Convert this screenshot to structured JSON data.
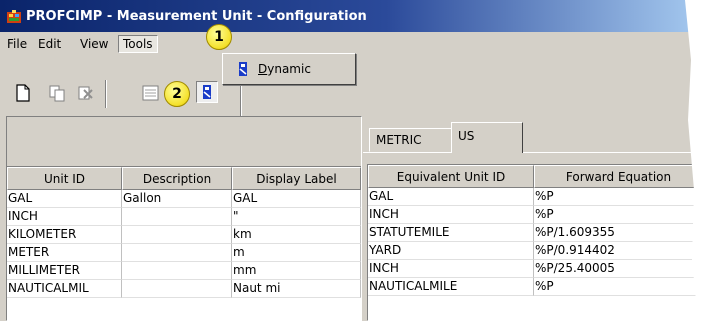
{
  "window": {
    "title": "PROFCIMP - Measurement Unit - Configuration",
    "title_icon": "profcimp-app-icon"
  },
  "menubar": {
    "items": [
      {
        "label": "File"
      },
      {
        "label": "Edit"
      },
      {
        "label": "View"
      },
      {
        "label": "Tools",
        "active": true
      }
    ]
  },
  "dropdown": {
    "items": [
      {
        "label": "Dynamic",
        "icon": "dynamic-icon"
      }
    ]
  },
  "toolbar": {
    "buttons": [
      "new-icon",
      "copy-icon",
      "delete-icon",
      "properties-icon",
      "dynamic-icon"
    ]
  },
  "callouts": [
    "1",
    "2"
  ],
  "left_grid": {
    "columns": [
      "Unit ID",
      "Description",
      "Display Label"
    ],
    "rows": [
      [
        "GAL",
        "Gallon",
        "GAL"
      ],
      [
        "INCH",
        "",
        "\""
      ],
      [
        "KILOMETER",
        "",
        "km"
      ],
      [
        "METER",
        "",
        "m"
      ],
      [
        "MILLIMETER",
        "",
        "mm"
      ],
      [
        "NAUTICALMIL",
        "",
        "Naut mi"
      ]
    ]
  },
  "tabs": [
    {
      "label": "METRIC"
    },
    {
      "label": "US",
      "selected": true
    }
  ],
  "right_grid": {
    "columns": [
      "Equivalent Unit ID",
      "Forward Equation"
    ],
    "rows": [
      [
        "GAL",
        "%P"
      ],
      [
        "INCH",
        "%P"
      ],
      [
        "STATUTEMILE",
        "%P/1.609355"
      ],
      [
        "YARD",
        "%P/0.914402"
      ],
      [
        "INCH",
        "%P/25.40005"
      ],
      [
        "NAUTICALMILE",
        "%P"
      ]
    ]
  },
  "colors": {
    "titlebar_start": "#0a246a",
    "titlebar_end": "#a6caf0",
    "face": "#d4d0c8",
    "callout": "#f4e02a"
  }
}
